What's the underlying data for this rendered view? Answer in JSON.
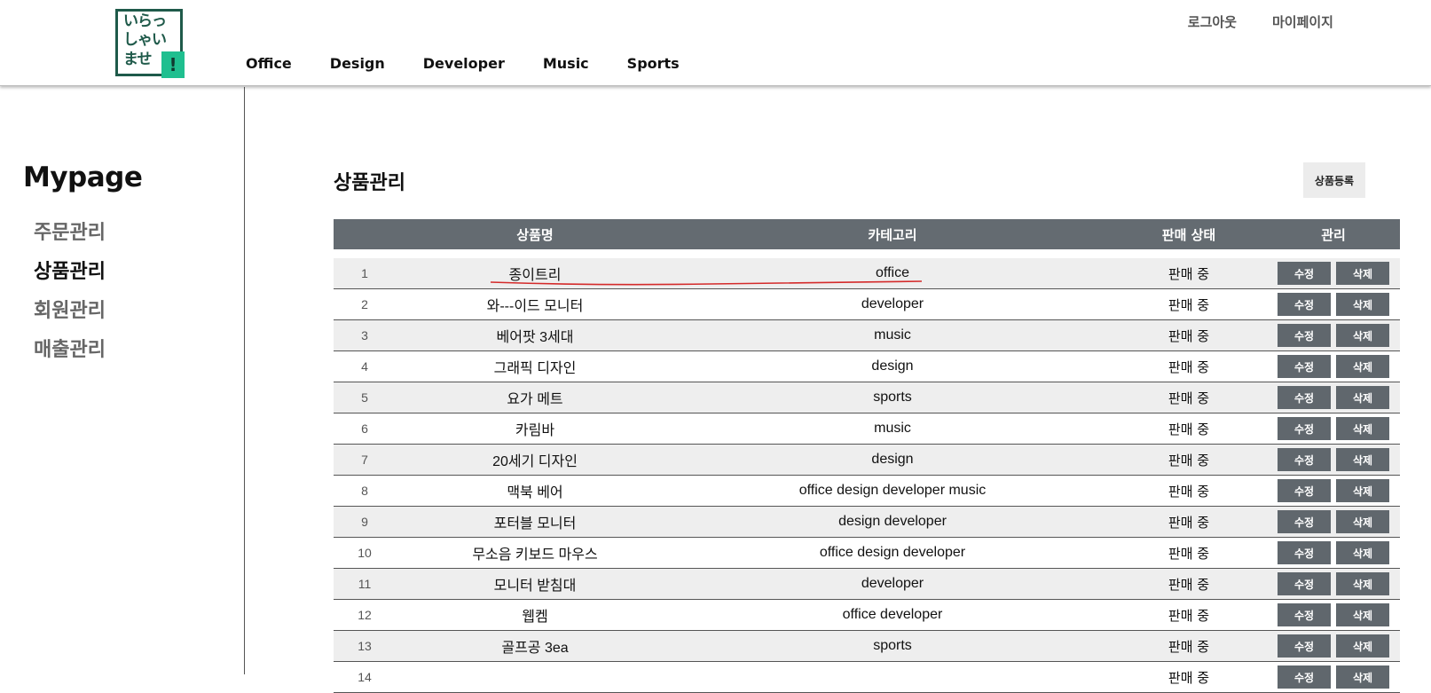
{
  "logo": {
    "line1": "いらっ",
    "line2": "しゃい",
    "line3": "ませ",
    "mark": "!"
  },
  "nav": [
    "Office",
    "Design",
    "Developer",
    "Music",
    "Sports"
  ],
  "util": {
    "logout": "로그아웃",
    "mypage": "마이페이지"
  },
  "sidebar": {
    "title": "Mypage",
    "items": [
      {
        "label": "주문관리",
        "active": false
      },
      {
        "label": "상품관리",
        "active": true
      },
      {
        "label": "회원관리",
        "active": false
      },
      {
        "label": "매출관리",
        "active": false
      }
    ]
  },
  "main": {
    "title": "상품관리",
    "register_label": "상품등록",
    "columns": [
      "",
      "상품명",
      "카테고리",
      "판매 상태",
      "관리"
    ],
    "edit_label": "수정",
    "delete_label": "삭제",
    "rows": [
      {
        "no": "1",
        "name": "종이트리",
        "category": "office",
        "status": "판매 중"
      },
      {
        "no": "2",
        "name": "와---이드 모니터",
        "category": "developer",
        "status": "판매 중"
      },
      {
        "no": "3",
        "name": "베어팟 3세대",
        "category": "music",
        "status": "판매 중"
      },
      {
        "no": "4",
        "name": "그래픽 디자인",
        "category": "design",
        "status": "판매 중"
      },
      {
        "no": "5",
        "name": "요가 메트",
        "category": "sports",
        "status": "판매 중"
      },
      {
        "no": "6",
        "name": "카림바",
        "category": "music",
        "status": "판매 중"
      },
      {
        "no": "7",
        "name": "20세기 디자인",
        "category": "design",
        "status": "판매 중"
      },
      {
        "no": "8",
        "name": "맥북 베어",
        "category": "office design developer music",
        "status": "판매 중"
      },
      {
        "no": "9",
        "name": "포터블 모니터",
        "category": "design developer",
        "status": "판매 중"
      },
      {
        "no": "10",
        "name": "무소음 키보드 마우스",
        "category": "office design developer",
        "status": "판매 중"
      },
      {
        "no": "11",
        "name": "모니터 받침대",
        "category": "developer",
        "status": "판매 중"
      },
      {
        "no": "12",
        "name": "웹켐",
        "category": "office developer",
        "status": "판매 중"
      },
      {
        "no": "13",
        "name": "골프공 3ea",
        "category": "sports",
        "status": "판매 중"
      },
      {
        "no": "14",
        "name": "",
        "category": "",
        "status": "판매 중"
      }
    ]
  },
  "colors": {
    "brand": "#1f5a4a",
    "brand_accent": "#1fbf8f",
    "table_header": "#646b71",
    "button": "#60676d",
    "annotation": "#d42a2a"
  }
}
